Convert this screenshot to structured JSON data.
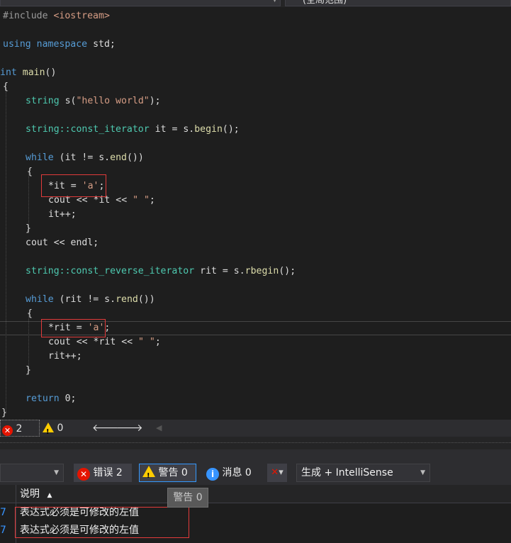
{
  "scope_bar": {
    "right_scope_label": "(全局范围)"
  },
  "code": {
    "line1_pp": "#include",
    "line1_header": "<iostream>",
    "line2_using": "using",
    "line2_namespace": "namespace",
    "line2_rest": "std;",
    "line3_int": "int",
    "line3_main": "main",
    "line3_parens": "()",
    "line4": "{",
    "line5_type": "string",
    "line5_a": "s(",
    "line5_str": "\"hello world\"",
    "line5_b": ");",
    "line6_type": "string::const_iterator",
    "line6_a": "it = s.",
    "line6_fn": "begin",
    "line6_b": "();",
    "line7_kw": "while",
    "line7_a": "(it != s.",
    "line7_fn": "end",
    "line7_b": "())",
    "line8": "{",
    "line9_a": "*it = ",
    "line9_str": "'a'",
    "line9_b": ";",
    "line10_a": "cout << *it << ",
    "line10_str": "\" \"",
    "line10_b": ";",
    "line11": "it++;",
    "line12": "}",
    "line13": "cout << endl;",
    "line14_type": "string::const_reverse_iterator",
    "line14_a": "rit = s.",
    "line14_fn": "rbegin",
    "line14_b": "();",
    "line15_kw": "while",
    "line15_a": "(rit != s.",
    "line15_fn": "rend",
    "line15_b": "())",
    "line16": "{",
    "line17_a": "*rit = ",
    "line17_str": "'a'",
    "line17_b": ";",
    "line18_a": "cout << *rit << ",
    "line18_str": "\" \"",
    "line18_b": ";",
    "line19": "rit++;",
    "line20": "}",
    "line21_kw": "return",
    "line21_rest": "0;",
    "line22": "}"
  },
  "status_bar": {
    "error_count": "2",
    "warning_count": "0"
  },
  "error_list": {
    "errors_button": "错误 2",
    "warnings_button": "警告 0",
    "messages_button": "消息 0",
    "build_source": "生成 + IntelliSense",
    "column_description": "说明",
    "tooltip": "警告 0",
    "rows": [
      {
        "line": "7",
        "description": "表达式必须是可修改的左值"
      },
      {
        "line": "7",
        "description": "表达式必须是可修改的左值"
      }
    ]
  },
  "colors": {
    "keyword": "#569cd6",
    "type": "#4ec9b0",
    "string": "#d69d85",
    "function": "#dcdcaa",
    "error_highlight": "#e23b3b",
    "accent": "#3794ff"
  }
}
